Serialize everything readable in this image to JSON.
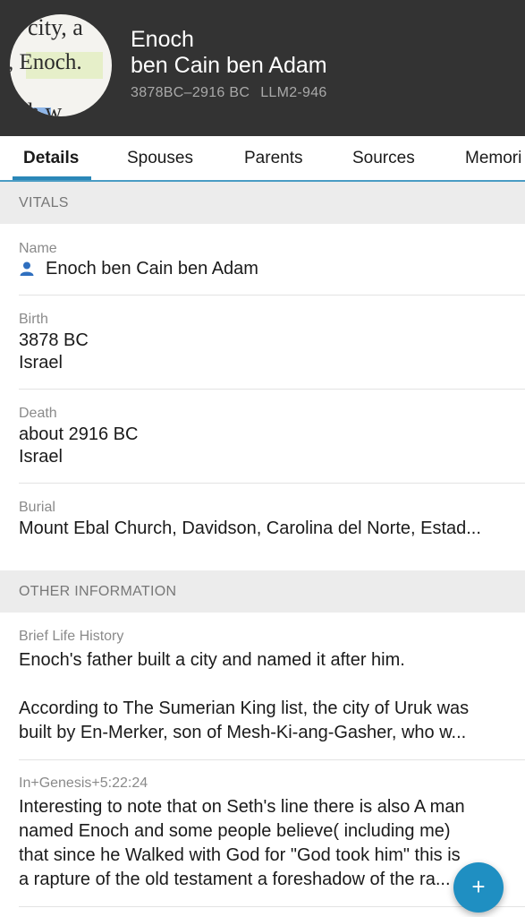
{
  "header": {
    "avatar_text": [
      "city, a",
      ", Enoch.",
      "h w"
    ],
    "given_name": "Enoch",
    "surname": "ben Cain ben Adam",
    "lifespan": "3878BC–2916 BC",
    "person_id": "LLM2-946"
  },
  "tabs": [
    "Details",
    "Spouses",
    "Parents",
    "Sources",
    "Memori"
  ],
  "vitals": {
    "section_title": "VITALS",
    "name_label": "Name",
    "name_value": "Enoch ben Cain ben Adam",
    "birth_label": "Birth",
    "birth_date": "3878 BC",
    "birth_place": "Israel",
    "death_label": "Death",
    "death_date": "about 2916 BC",
    "death_place": "Israel",
    "burial_label": "Burial",
    "burial_value": "Mount Ebal Church, Davidson, Carolina del Norte, Estad..."
  },
  "other": {
    "section_title": "OTHER INFORMATION",
    "life_label": "Brief Life History",
    "life_line1": "Enoch's father built a city and named it after him.",
    "life_line2": "According to The Sumerian King list, the city of Uruk was",
    "life_line3": "built by En-Merker, son of Mesh-Ki-ang-Gasher, who w...",
    "note_label": "In+Genesis+5:22:24",
    "note_line1": "Interesting to note that on Seth's line there is also A man",
    "note_line2": "named Enoch and some people believe( including me)",
    "note_line3": "that since he Walked with God for \"God took him\" this is",
    "note_line4": "a rapture of the old testament a foreshadow of the ra..."
  },
  "fab_label": "+",
  "colors": {
    "header_bg": "#333333",
    "accent": "#2a87b8",
    "fab": "#1f8fc2"
  }
}
